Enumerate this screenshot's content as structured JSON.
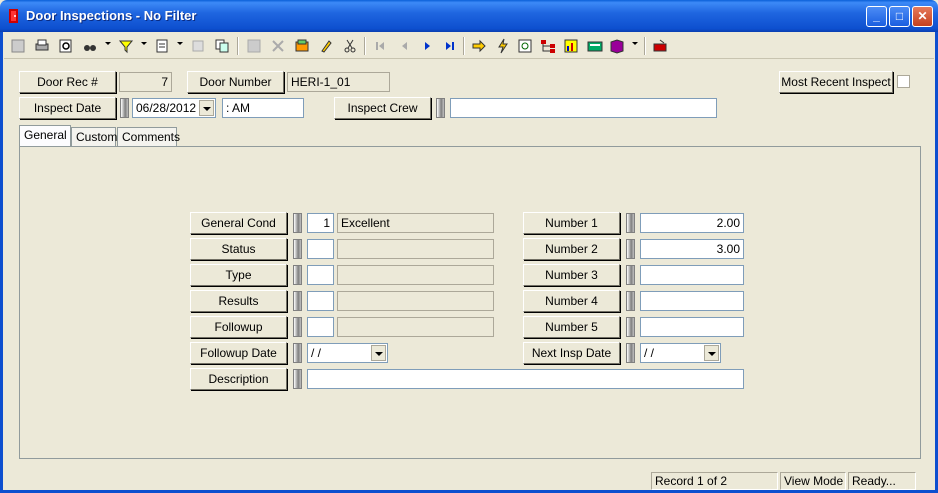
{
  "window": {
    "title": "Door Inspections - No Filter"
  },
  "header": {
    "door_rec_label": "Door Rec #",
    "door_rec_value": "7",
    "door_number_label": "Door Number",
    "door_number_value": "HERI-1_01",
    "most_recent_label": "Most Recent Inspect",
    "inspect_date_label": "Inspect Date",
    "inspect_date_value": "06/28/2012",
    "inspect_time_value": "  :  AM",
    "inspect_crew_label": "Inspect Crew",
    "inspect_crew_value": ""
  },
  "tabs": [
    {
      "label": "General"
    },
    {
      "label": "Custom"
    },
    {
      "label": "Comments"
    }
  ],
  "general": {
    "general_cond_label": "General Cond",
    "general_cond_code": "1",
    "general_cond_desc": "Excellent",
    "status_label": "Status",
    "type_label": "Type",
    "results_label": "Results",
    "followup_label": "Followup",
    "followup_date_label": "Followup Date",
    "followup_date_value": " / /",
    "description_label": "Description",
    "description_value": "",
    "number1_label": "Number 1",
    "number1_value": "2.00",
    "number2_label": "Number 2",
    "number2_value": "3.00",
    "number3_label": "Number 3",
    "number4_label": "Number 4",
    "number5_label": "Number 5",
    "next_insp_date_label": "Next Insp Date",
    "next_insp_date_value": " / /"
  },
  "status": {
    "record": "Record 1 of 2",
    "mode": "View Mode",
    "state": "Ready..."
  },
  "colors": {
    "titlebar": "#0d4fcf",
    "background": "#ece9d8"
  }
}
